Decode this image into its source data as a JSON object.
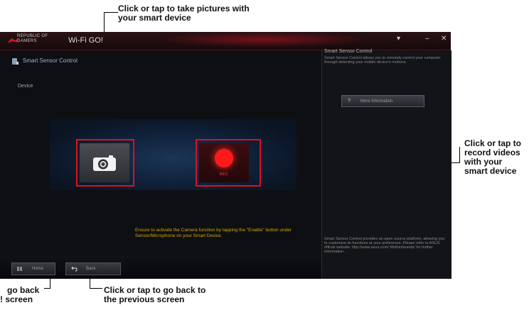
{
  "annotations": {
    "take_pictures": [
      "Click or tap to take pictures with",
      "your smart device"
    ],
    "record_videos": [
      "Click or tap to",
      "record videos",
      "with your",
      "smart device"
    ],
    "go_back_home": [
      "go back",
      "! screen"
    ],
    "go_back_previous": [
      "Click or tap to go back to",
      "the previous screen"
    ]
  },
  "window": {
    "brand_line1": "REPUBLIC OF",
    "brand_line2": "GAMERS",
    "title": "Wi-Fi GO!",
    "controls": {
      "dropdown": "▾",
      "minimize": "–",
      "close": "✕"
    }
  },
  "main": {
    "page_title": "Smart Sensor Control",
    "device_label": "Device",
    "rec_text": "REC",
    "hint": "Ensure to activate the Camera function by tapping the \"Enable\" button under Sensor/Microphone on your Smart Device."
  },
  "footer": {
    "home_label": "Home",
    "back_label": "Back"
  },
  "right_panel": {
    "title": "Smart Sensor Control",
    "description": "Smart Sensor Control allows you to remotely control your computer through detecting your mobile device's motions.",
    "more_info_label": "More Information",
    "more_info_icon": "?",
    "footer_text": "Smart Sensor Control provides an open source platform, allowing you to customize its functions at your preference. Please refer to ASUS official website: http://www.asus.com/ Motherboards/ for further information."
  },
  "colors": {
    "accent": "#e0101a",
    "hint": "#d2a800",
    "rec": "#ff1a1a"
  }
}
